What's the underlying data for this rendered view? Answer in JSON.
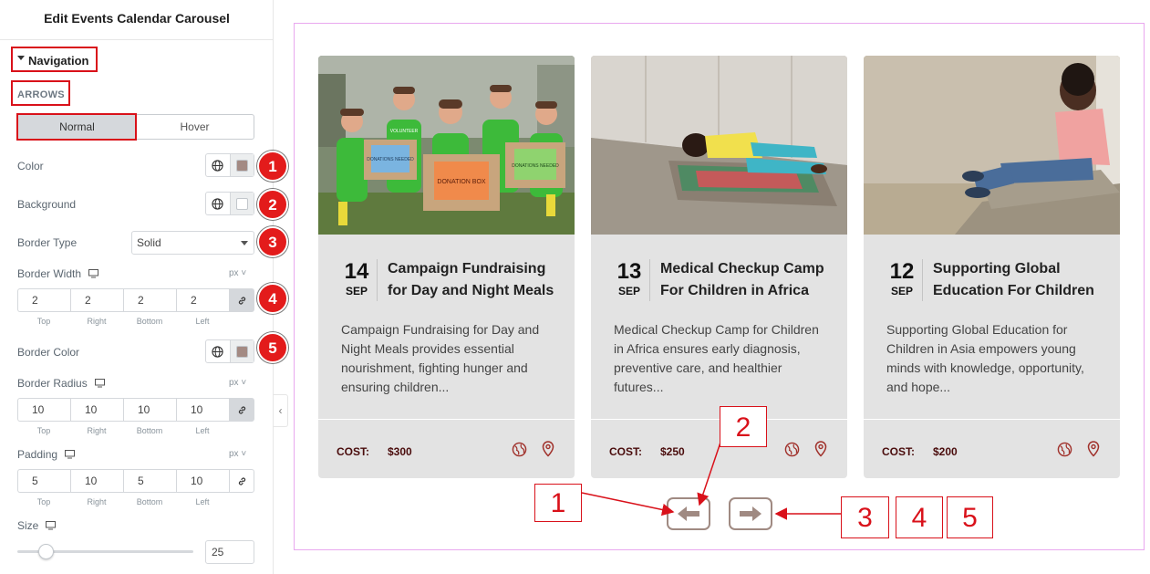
{
  "panel": {
    "title": "Edit Events Calendar Carousel",
    "section": "Navigation",
    "subsection": "ARROWS",
    "tabs": [
      "Normal",
      "Hover"
    ],
    "labels": {
      "color": "Color",
      "background": "Background",
      "border_type": "Border Type",
      "border_width": "Border Width",
      "border_color": "Border Color",
      "border_radius": "Border Radius",
      "padding": "Padding",
      "size": "Size"
    },
    "border_type_value": "Solid",
    "unit": "px",
    "dim_labels": [
      "Top",
      "Right",
      "Bottom",
      "Left"
    ],
    "border_width": [
      "2",
      "2",
      "2",
      "2"
    ],
    "border_radius": [
      "10",
      "10",
      "10",
      "10"
    ],
    "padding": [
      "5",
      "10",
      "5",
      "10"
    ],
    "size_value": "25",
    "size_fraction": 0.14,
    "badges": [
      "1",
      "2",
      "3",
      "4",
      "5"
    ],
    "swatch_colors": {
      "color": "#a38a83",
      "background": "#ffffff",
      "border_color": "#a38a83"
    }
  },
  "events": [
    {
      "day": "14",
      "month": "SEP",
      "title": "Campaign Fundraising for Day and Night Meals",
      "desc": "Campaign Fundraising for Day and Night Meals provides essential nourishment, fighting hunger and ensuring children...",
      "cost_label": "COST:",
      "price": "$300",
      "image": "volunteers holding donation boxes",
      "box_labels": [
        "VOLUNTEER",
        "DONATIONS NEEDED",
        "DONATION BOX",
        "DONATIONS NEEDED"
      ]
    },
    {
      "day": "13",
      "month": "SEP",
      "title": "Medical Checkup Camp For Children in Africa",
      "desc": "Medical Checkup Camp for Children in Africa ensures early diagnosis, preventive care, and healthier futures...",
      "cost_label": "COST:",
      "price": "$250",
      "image": "child lying on a mat on the street"
    },
    {
      "day": "12",
      "month": "SEP",
      "title": "Supporting Global Education For Children",
      "desc": "Supporting Global Education for Children in Asia empowers young minds with knowledge, opportunity, and hope...",
      "cost_label": "COST:",
      "price": "$200",
      "image": "child sitting on a concrete step"
    }
  ],
  "callouts": [
    "1",
    "2",
    "3",
    "4",
    "5"
  ],
  "colors": {
    "accent_red": "#d9111a",
    "arrow": "#a08a82",
    "cost_text": "#4a0c0c",
    "preview_border": "#e9a8ef"
  }
}
